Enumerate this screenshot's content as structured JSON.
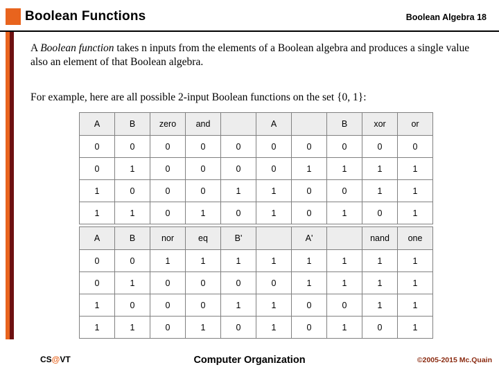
{
  "header": {
    "title": "Boolean Functions",
    "right_label": "Boolean Algebra 18"
  },
  "body": {
    "para1_a": "A ",
    "para1_italic": "Boolean function",
    "para1_b": " takes n inputs from the elements of a Boolean algebra and produces a single value also an element of that Boolean algebra.",
    "para2": "For example, here are all possible 2-input Boolean functions on the set {0, 1}:"
  },
  "table1": {
    "headers": [
      "A",
      "B",
      "zero",
      "and",
      "",
      "A",
      "",
      "B",
      "xor",
      "or"
    ],
    "rows": [
      [
        "0",
        "0",
        "0",
        "0",
        "0",
        "0",
        "0",
        "0",
        "0",
        "0"
      ],
      [
        "0",
        "1",
        "0",
        "0",
        "0",
        "0",
        "1",
        "1",
        "1",
        "1"
      ],
      [
        "1",
        "0",
        "0",
        "0",
        "1",
        "1",
        "0",
        "0",
        "1",
        "1"
      ],
      [
        "1",
        "1",
        "0",
        "1",
        "0",
        "1",
        "0",
        "1",
        "0",
        "1"
      ]
    ]
  },
  "table2": {
    "headers": [
      "A",
      "B",
      "nor",
      "eq",
      "B'",
      "",
      "A'",
      "",
      "nand",
      "one"
    ],
    "rows": [
      [
        "0",
        "0",
        "1",
        "1",
        "1",
        "1",
        "1",
        "1",
        "1",
        "1"
      ],
      [
        "0",
        "1",
        "0",
        "0",
        "0",
        "0",
        "1",
        "1",
        "1",
        "1"
      ],
      [
        "1",
        "0",
        "0",
        "0",
        "1",
        "1",
        "0",
        "0",
        "1",
        "1"
      ],
      [
        "1",
        "1",
        "0",
        "1",
        "0",
        "1",
        "0",
        "1",
        "0",
        "1"
      ]
    ]
  },
  "footer": {
    "left_cs": "CS",
    "left_at": "@",
    "left_vt": "VT",
    "center": "Computer Organization",
    "right": "©2005-2015 Mc.Quain"
  }
}
